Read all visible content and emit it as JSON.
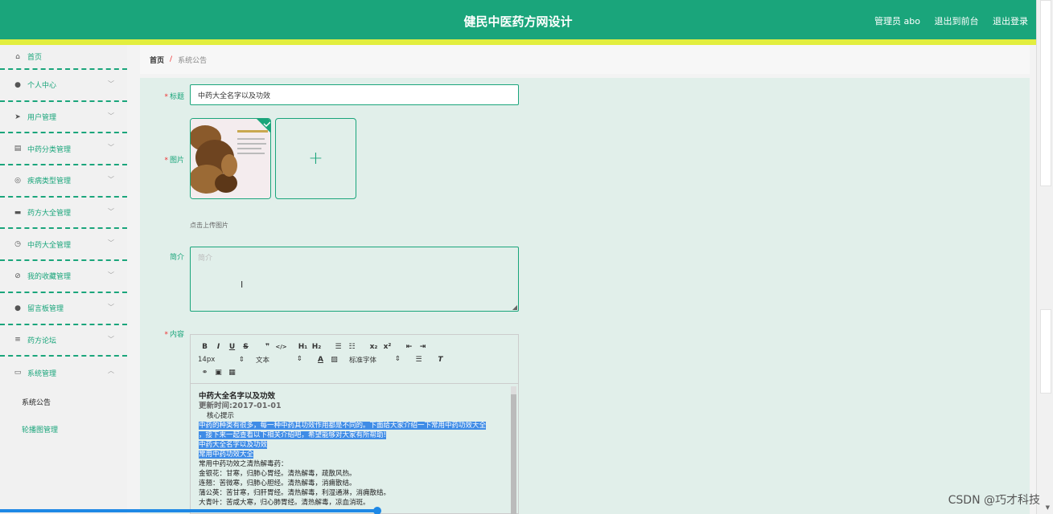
{
  "header": {
    "title": "健民中医药方网设计",
    "links": [
      "管理员 abo",
      "退出到前台",
      "退出登录"
    ]
  },
  "sidebar": {
    "items": [
      {
        "label": "首页",
        "icon": "home-icon",
        "glyph": "⌂"
      },
      {
        "label": "个人中心",
        "icon": "user-icon",
        "glyph": "●"
      },
      {
        "label": "用户管理",
        "icon": "send-icon",
        "glyph": "➤"
      },
      {
        "label": "中药分类管理",
        "icon": "clipboard-icon",
        "glyph": "▤"
      },
      {
        "label": "疾病类型管理",
        "icon": "circle-icon",
        "glyph": "◎"
      },
      {
        "label": "药方大全管理",
        "icon": "comment-icon",
        "glyph": "▬"
      },
      {
        "label": "中药大全管理",
        "icon": "compass-icon",
        "glyph": "◷"
      },
      {
        "label": "我的收藏管理",
        "icon": "bell-off-icon",
        "glyph": "⊘"
      },
      {
        "label": "留言板管理",
        "icon": "user-icon",
        "glyph": "●"
      },
      {
        "label": "药方论坛",
        "icon": "list-icon",
        "glyph": "≡"
      },
      {
        "label": "系统管理",
        "icon": "monitor-icon",
        "glyph": "▭"
      }
    ],
    "sub_items": [
      "系统公告",
      "轮播图管理"
    ]
  },
  "breadcrumb": {
    "home": "首页",
    "separator": "/",
    "current": "系统公告"
  },
  "form": {
    "title_label": "标题",
    "title_value": "中药大全名字以及功效",
    "image_label": "图片",
    "upload_hint": "点击上传图片",
    "intro_label": "简介",
    "intro_placeholder": "简介",
    "content_label": "内容"
  },
  "editor": {
    "row1": [
      "B",
      "I",
      "U",
      "S",
      "❞",
      "</>",
      "H₁",
      "H₂",
      "☰",
      "☷",
      "x₂",
      "x²",
      "⇤",
      "⇥"
    ],
    "font_size": "14px",
    "text_style": "文本",
    "font_family": "标准字体",
    "heading": "中药大全名字以及功效",
    "date": "更新时间:2017-01-01",
    "tip": "核心提示",
    "p1": "中药的种类有很多，每一种中药其功效作用都是不同的。下面给大家介绍一下常用中药功效大全",
    "p2": "，接下来一起查看以下相关介绍吧，希望能够对大家有所帮助!",
    "p3": "中药大全名字以及功效",
    "p4": "常用中药功效大全",
    "l1": "常用中药功效之清热解毒药：",
    "l2": "金银花：甘寒，归肺心胃经。清热解毒，疏散风热。",
    "l3": "连翘：苦微寒，归肺心胆经。清热解毒，消痈散结。",
    "l4": "蒲公英：苦甘寒，归肝胃经。清热解毒，利湿通淋，消痈散结。",
    "l5": "大青叶：苦咸大寒，归心肺胃经。清热解毒，凉血消斑。"
  },
  "watermark": "CSDN @巧才科技",
  "colors": {
    "primary": "#1aa57b",
    "accent_bar": "#e2ee3e",
    "panel": "#e1efea"
  }
}
